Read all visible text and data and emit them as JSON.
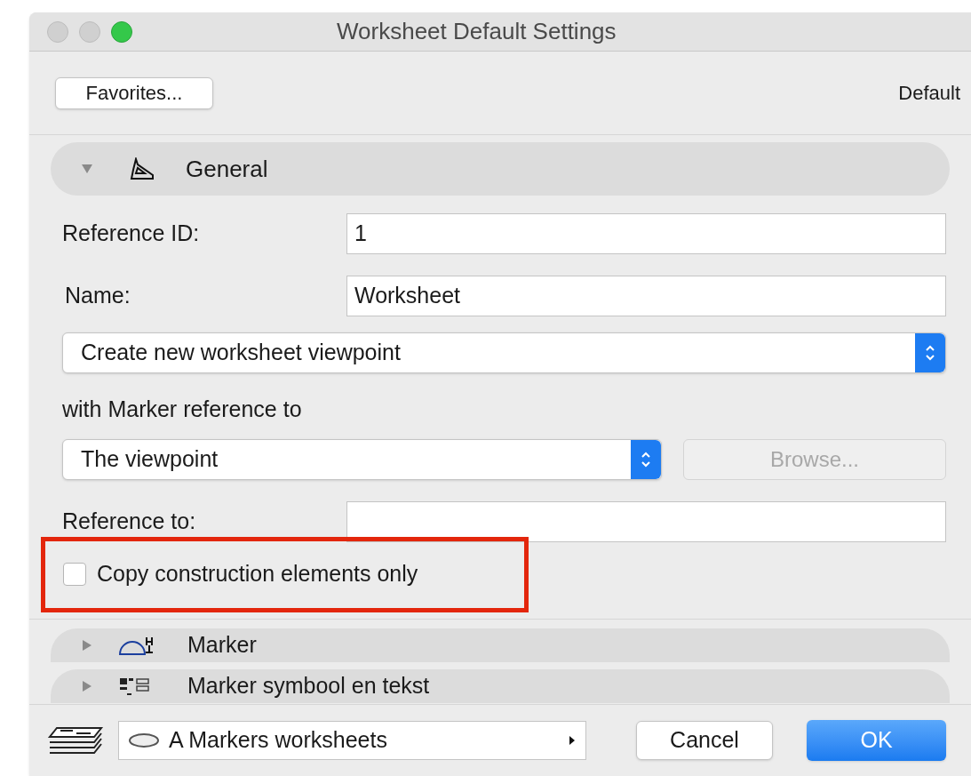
{
  "window": {
    "title": "Worksheet Default Settings",
    "traffic_lights": [
      {
        "kind": "close",
        "active": false
      },
      {
        "kind": "minimize",
        "active": false
      },
      {
        "kind": "zoom",
        "active": true
      }
    ]
  },
  "toolbar": {
    "favorites_button": "Favorites...",
    "status": "Default"
  },
  "general": {
    "title": "General",
    "expanded": true,
    "reference_id": {
      "label": "Reference ID:",
      "value": "1"
    },
    "name": {
      "label": "Name:",
      "value": "Worksheet"
    },
    "mode_select": {
      "value": "Create new worksheet viewpoint"
    },
    "marker_reference_label": "with Marker reference to",
    "marker_reference_select": {
      "value": "The viewpoint"
    },
    "browse_button": {
      "label": "Browse...",
      "disabled": true
    },
    "reference_to": {
      "label": "Reference to:"
    },
    "copy_checkbox": {
      "label": "Copy construction elements only",
      "checked": false,
      "highlighted": true
    }
  },
  "sections": [
    {
      "kind": "marker",
      "title": "Marker",
      "expanded": false
    },
    {
      "kind": "symbol",
      "title": "Marker symbool en tekst",
      "expanded": false
    }
  ],
  "footer": {
    "layer_select": "A Markers worksheets",
    "cancel": "Cancel",
    "ok": "OK"
  }
}
